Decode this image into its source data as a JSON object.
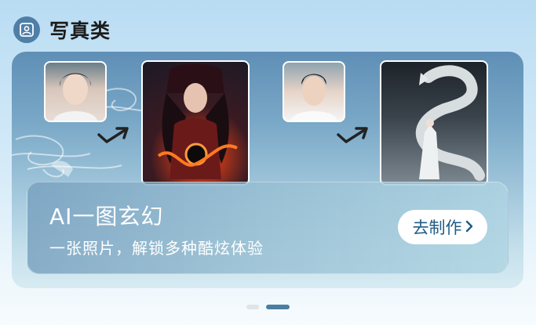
{
  "header": {
    "title": "写真类",
    "icon": "portrait-photo-icon"
  },
  "banner": {
    "title": "AI一图玄幻",
    "subtitle": "一张照片，解锁多种酷炫体验",
    "cta_label": "去制作",
    "cta_icon": "chevron-right-icon",
    "examples": [
      {
        "before": "female-portrait-photo",
        "after": "fantasy-fire-sorceress-image"
      },
      {
        "before": "male-portrait-photo",
        "after": "fantasy-white-dragon-image"
      }
    ]
  },
  "pager": {
    "count": 2,
    "active_index": 1
  },
  "colors": {
    "accent": "#4a7fa3",
    "cta_text": "#1f5c86",
    "header_icon_bg": "#4f7fa6"
  }
}
